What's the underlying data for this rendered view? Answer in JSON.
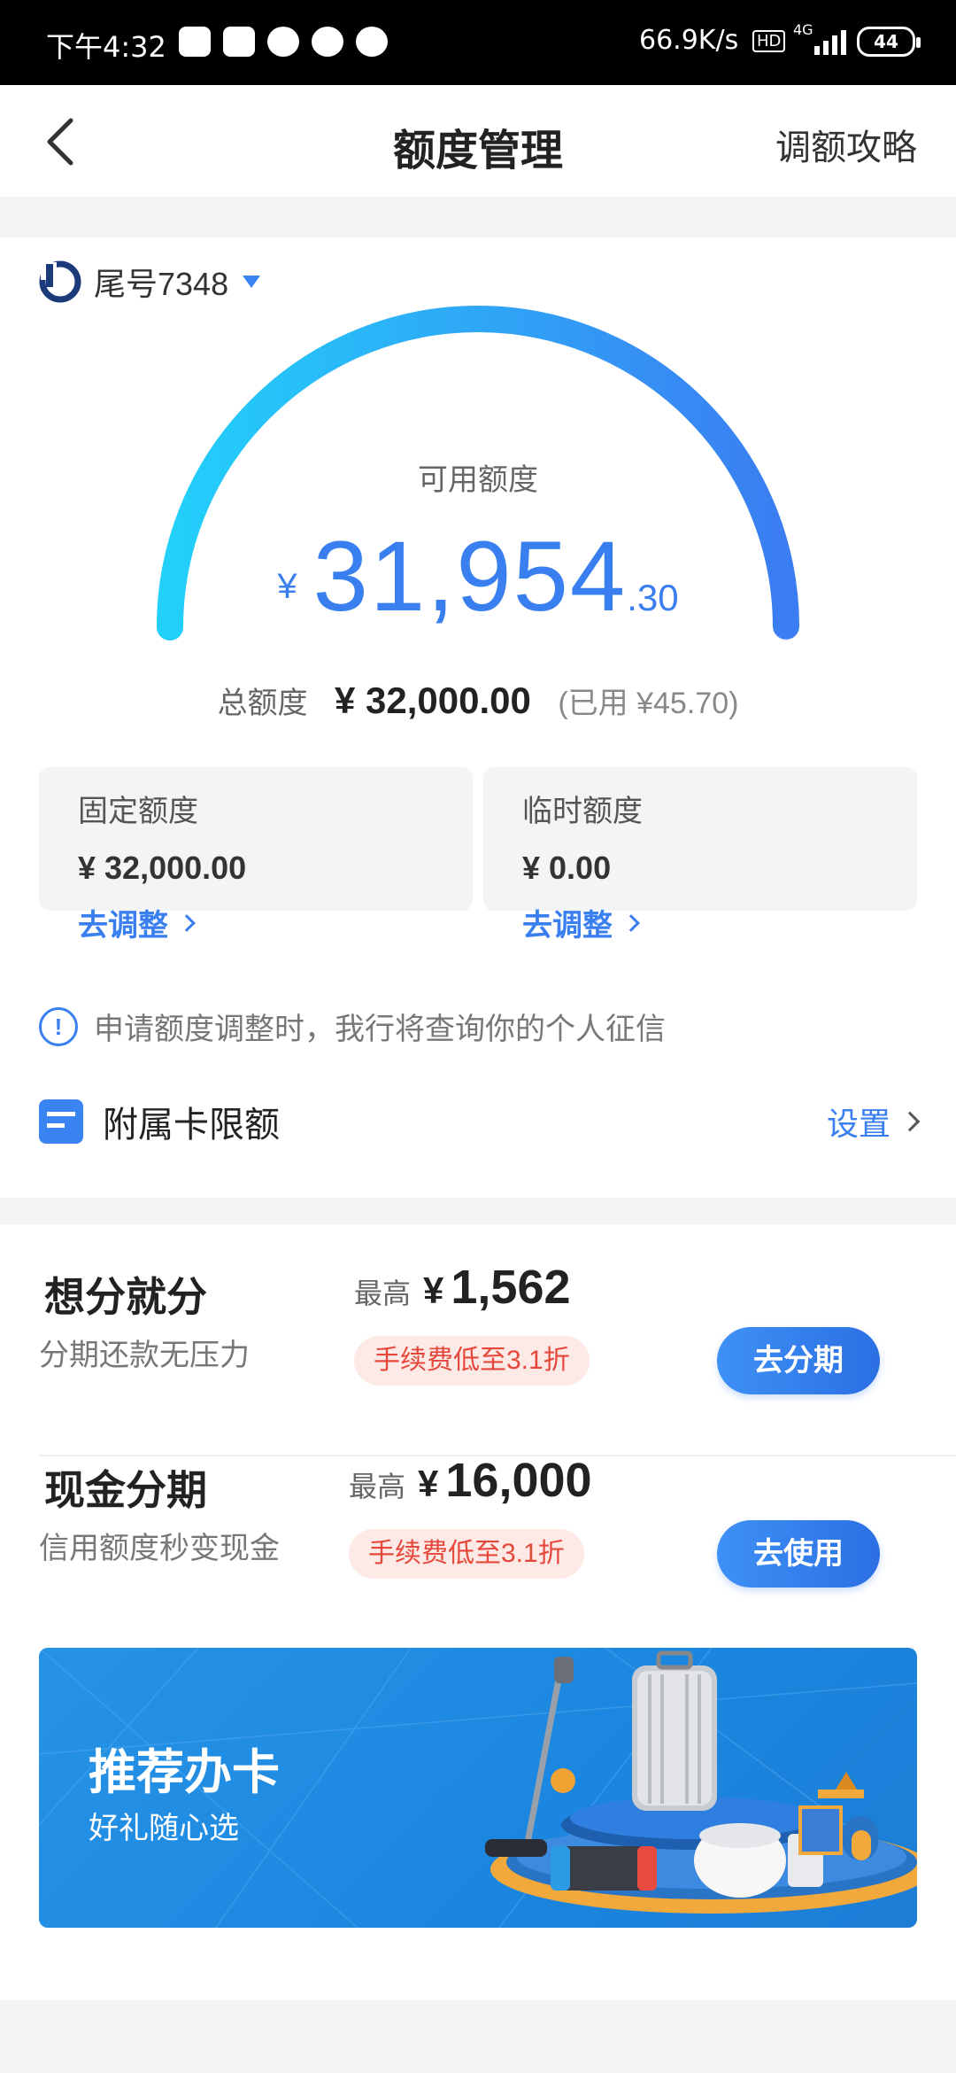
{
  "status_bar": {
    "time": "下午4:32",
    "network_speed": "66.9K/s",
    "hd": "HD",
    "network": "4G",
    "battery": "44"
  },
  "nav": {
    "title": "额度管理",
    "right_link": "调额攻略"
  },
  "card": {
    "label": "尾号7348"
  },
  "available": {
    "label": "可用额度",
    "currency": "¥",
    "integer": "31,954",
    "decimal": ".30",
    "fraction_of_total": 0.9986
  },
  "total": {
    "label": "总额度",
    "value": "¥ 32,000.00",
    "used": "(已用 ¥45.70)"
  },
  "quotas": [
    {
      "label": "固定额度",
      "value": "¥ 32,000.00",
      "link": "去调整"
    },
    {
      "label": "临时额度",
      "value": "¥ 0.00",
      "link": "去调整"
    }
  ],
  "notice": {
    "icon_text": "!",
    "text": "申请额度调整时，我行将查询你的个人征信"
  },
  "sub_card": {
    "title": "附属卡限额",
    "link": "设置"
  },
  "offers": [
    {
      "title": "想分就分",
      "subtitle": "分期还款无压力",
      "max_label": "最高",
      "currency": "¥",
      "max_value": "1,562",
      "fee": "手续费低至3.1折",
      "button": "去分期"
    },
    {
      "title": "现金分期",
      "subtitle": "信用额度秒变现金",
      "max_label": "最高",
      "currency": "¥",
      "max_value": "16,000",
      "fee": "手续费低至3.1折",
      "button": "去使用"
    }
  ],
  "banner": {
    "title": "推荐办卡",
    "subtitle": "好礼随心选"
  },
  "colors": {
    "accent": "#3a7ff0",
    "gauge_start": "#22d0fa",
    "gauge_end": "#3b7df2",
    "fee_text": "#e5483b",
    "fee_bg": "#fde9e6",
    "banner": "#1a86df"
  },
  "icons": {
    "back": "chevron-left-icon",
    "caret": "caret-down-icon",
    "info": "info-circle-icon",
    "card": "card-icon",
    "chevron": "chevron-right-icon"
  }
}
